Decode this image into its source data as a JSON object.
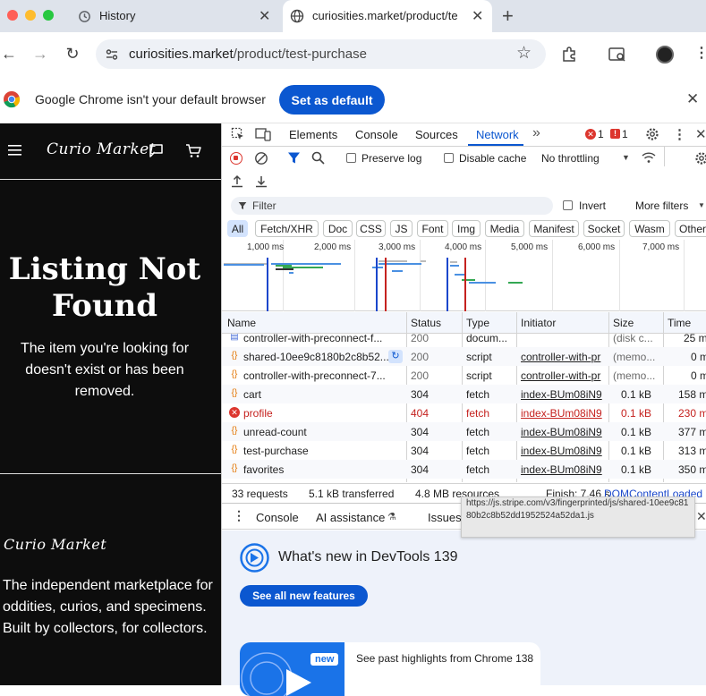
{
  "browser": {
    "tabs": [
      {
        "title": "History",
        "icon": "history-icon"
      },
      {
        "title": "curiosities.market/product/te",
        "icon": "globe-icon",
        "active": true
      }
    ],
    "new_tab_symbol": "+",
    "url_domain": "curiosities.market",
    "url_path": "/product/test-purchase",
    "infobar": {
      "message": "Google Chrome isn't your default browser",
      "button": "Set as default"
    }
  },
  "site": {
    "logo": "Curio Market",
    "heading": "Listing Not Found",
    "message": "The item you're looking for doesn't exist or has been removed.",
    "footer_logo": "Curio Market",
    "footer_desc": "The independent marketplace for oddities, curios, and specimens. Built by collectors, for collectors."
  },
  "devtools": {
    "tabs": [
      "Elements",
      "Console",
      "Sources",
      "Network"
    ],
    "more_tabs": "»",
    "error_count": "1",
    "issue_count": "1",
    "network": {
      "preserve_log": "Preserve log",
      "disable_cache": "Disable cache",
      "throttling": "No throttling",
      "filter_placeholder": "Filter",
      "invert": "Invert",
      "more_filters": "More filters",
      "chips": [
        "All",
        "Fetch/XHR",
        "Doc",
        "CSS",
        "JS",
        "Font",
        "Img",
        "Media",
        "Manifest",
        "Socket",
        "Wasm",
        "Other"
      ],
      "timeline_ticks": [
        "1,000 ms",
        "2,000 ms",
        "3,000 ms",
        "4,000 ms",
        "5,000 ms",
        "6,000 ms",
        "7,000 ms"
      ],
      "columns": [
        "Name",
        "Status",
        "Type",
        "Initiator",
        "Size",
        "Time"
      ],
      "rows": [
        {
          "name": "controller-with-preconnect-f...",
          "status": "200",
          "type": "docum...",
          "initiator": "",
          "size": "(disk c...",
          "time": "25 m",
          "icon": "document-icon",
          "faded": true
        },
        {
          "name": "shared-10ee9c8180b2c8b52...",
          "status": "200",
          "type": "script",
          "initiator": "controller-with-pr",
          "size": "(memo...",
          "time": "0 m",
          "icon": "script-icon"
        },
        {
          "name": "controller-with-preconnect-7...",
          "status": "200",
          "type": "script",
          "initiator": "controller-with-pr",
          "size": "(memo...",
          "time": "0 m",
          "icon": "script-icon"
        },
        {
          "name": "cart",
          "status": "304",
          "type": "fetch",
          "initiator": "index-BUm08iN9",
          "size": "0.1 kB",
          "time": "158 m",
          "icon": "fetch-icon"
        },
        {
          "name": "profile",
          "status": "404",
          "type": "fetch",
          "initiator": "index-BUm08iN9",
          "size": "0.1 kB",
          "time": "230 m",
          "icon": "error-icon",
          "error": true
        },
        {
          "name": "unread-count",
          "status": "304",
          "type": "fetch",
          "initiator": "index-BUm08iN9",
          "size": "0.1 kB",
          "time": "377 m",
          "icon": "fetch-icon"
        },
        {
          "name": "test-purchase",
          "status": "304",
          "type": "fetch",
          "initiator": "index-BUm08iN9",
          "size": "0.1 kB",
          "time": "313 m",
          "icon": "fetch-icon"
        },
        {
          "name": "favorites",
          "status": "304",
          "type": "fetch",
          "initiator": "index-BUm08iN9",
          "size": "0.1 kB",
          "time": "350 m",
          "icon": "fetch-icon"
        }
      ],
      "summary": {
        "requests": "33 requests",
        "transferred": "5.1 kB transferred",
        "resources": "4.8 MB resources",
        "finish": "Finish: 7.46 s",
        "dcl": "DOMContentLoaded"
      },
      "tooltip": "https://js.stripe.com/v3/fingerprinted/js/shared-10ee9c8180b2c8b52dd1952524a52da1.js"
    },
    "drawer": {
      "tabs": [
        "Console",
        "AI assistance",
        "Issues"
      ],
      "whats_new_title": "What's new in DevTools 139",
      "see_all": "See all new features",
      "badge": "new",
      "highlight_text": "See past highlights from Chrome 138"
    }
  },
  "colors": {
    "accent": "#0b57d0",
    "error": "#c5221f",
    "site_bg": "#0d0d0d"
  }
}
